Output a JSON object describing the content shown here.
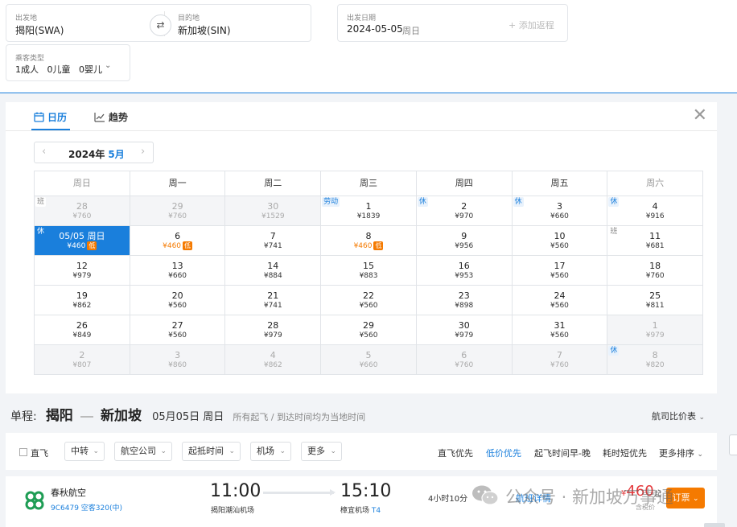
{
  "search": {
    "from_label": "出发地",
    "from_value": "揭阳(SWA)",
    "to_label": "目的地",
    "to_value": "新加坡(SIN)",
    "date_label": "出发日期",
    "date_value": "2024-05-05",
    "date_weekday": "周日",
    "add_trip": "+ 添加返程",
    "pax_label": "乘客类型",
    "pax_value": "1成人   0儿童   0婴儿"
  },
  "calendar": {
    "tab_calendar": "日历",
    "tab_trend": "趋势",
    "year": "2024年",
    "month": "5月",
    "weekdays": [
      "周日",
      "周一",
      "周二",
      "周三",
      "周四",
      "周五",
      "周六"
    ],
    "weeks": [
      [
        {
          "day": "28",
          "price": "¥760",
          "other": true,
          "badge": "班"
        },
        {
          "day": "29",
          "price": "¥760",
          "other": true
        },
        {
          "day": "30",
          "price": "¥1529",
          "other": true
        },
        {
          "day": "1",
          "price": "¥1839",
          "badge": "劳动"
        },
        {
          "day": "2",
          "price": "¥970",
          "badge": "休"
        },
        {
          "day": "3",
          "price": "¥660",
          "badge": "休"
        },
        {
          "day": "4",
          "price": "¥916",
          "badge": "休"
        }
      ],
      [
        {
          "day": "05/05 周日",
          "price": "¥460",
          "low": true,
          "selected": true,
          "badge": "休"
        },
        {
          "day": "6",
          "price": "¥460",
          "low": true
        },
        {
          "day": "7",
          "price": "¥741"
        },
        {
          "day": "8",
          "price": "¥460",
          "low": true
        },
        {
          "day": "9",
          "price": "¥956"
        },
        {
          "day": "10",
          "price": "¥560"
        },
        {
          "day": "11",
          "price": "¥681",
          "badge": "班"
        }
      ],
      [
        {
          "day": "12",
          "price": "¥979"
        },
        {
          "day": "13",
          "price": "¥660"
        },
        {
          "day": "14",
          "price": "¥884"
        },
        {
          "day": "15",
          "price": "¥883"
        },
        {
          "day": "16",
          "price": "¥953"
        },
        {
          "day": "17",
          "price": "¥560"
        },
        {
          "day": "18",
          "price": "¥760"
        }
      ],
      [
        {
          "day": "19",
          "price": "¥862"
        },
        {
          "day": "20",
          "price": "¥560"
        },
        {
          "day": "21",
          "price": "¥741"
        },
        {
          "day": "22",
          "price": "¥560"
        },
        {
          "day": "23",
          "price": "¥898"
        },
        {
          "day": "24",
          "price": "¥560"
        },
        {
          "day": "25",
          "price": "¥811"
        }
      ],
      [
        {
          "day": "26",
          "price": "¥849"
        },
        {
          "day": "27",
          "price": "¥560"
        },
        {
          "day": "28",
          "price": "¥979"
        },
        {
          "day": "29",
          "price": "¥560"
        },
        {
          "day": "30",
          "price": "¥979"
        },
        {
          "day": "31",
          "price": "¥560"
        },
        {
          "day": "1",
          "price": "¥979",
          "other": true
        }
      ],
      [
        {
          "day": "2",
          "price": "¥807",
          "other": true
        },
        {
          "day": "3",
          "price": "¥860",
          "other": true
        },
        {
          "day": "4",
          "price": "¥862",
          "other": true
        },
        {
          "day": "5",
          "price": "¥660",
          "other": true
        },
        {
          "day": "6",
          "price": "¥760",
          "other": true
        },
        {
          "day": "7",
          "price": "¥760",
          "other": true
        },
        {
          "day": "8",
          "price": "¥820",
          "other": true,
          "badge": "休"
        }
      ]
    ],
    "low_tag": "低"
  },
  "route": {
    "label": "单程:",
    "from_city": "揭阳",
    "to_city": "新加坡",
    "date": "05月05日 周日",
    "note": "所有起飞 / 到达时间均为当地时间",
    "compare": "航司比价表"
  },
  "filters": {
    "direct": "直飞",
    "dropdowns": [
      "中转",
      "航空公司",
      "起抵时间",
      "机场",
      "更多"
    ],
    "sorts": [
      "直飞优先",
      "低价优先",
      "起飞时间早-晚",
      "耗时短优先",
      "更多排序"
    ]
  },
  "flight": {
    "airline": "春秋航空",
    "flight_no": "9C6479 空客320(中)",
    "dep_time": "11:00",
    "dep_airport": "揭阳潮汕机场",
    "arr_time": "15:10",
    "arr_airport": "樟宜机场",
    "arr_terminal": "T4",
    "duration": "4小时10分",
    "detail": "航班详情",
    "price_symbol": "¥",
    "price": "460",
    "price_suffix": "起",
    "tax": "含税价",
    "book": "订票"
  },
  "watermark": "公众号 · 新加坡万事通",
  "colors": {
    "accent": "#1a7fdc",
    "low_price": "#f57a00",
    "price": "#e4393c",
    "airline_logo": "#1f9d55"
  }
}
